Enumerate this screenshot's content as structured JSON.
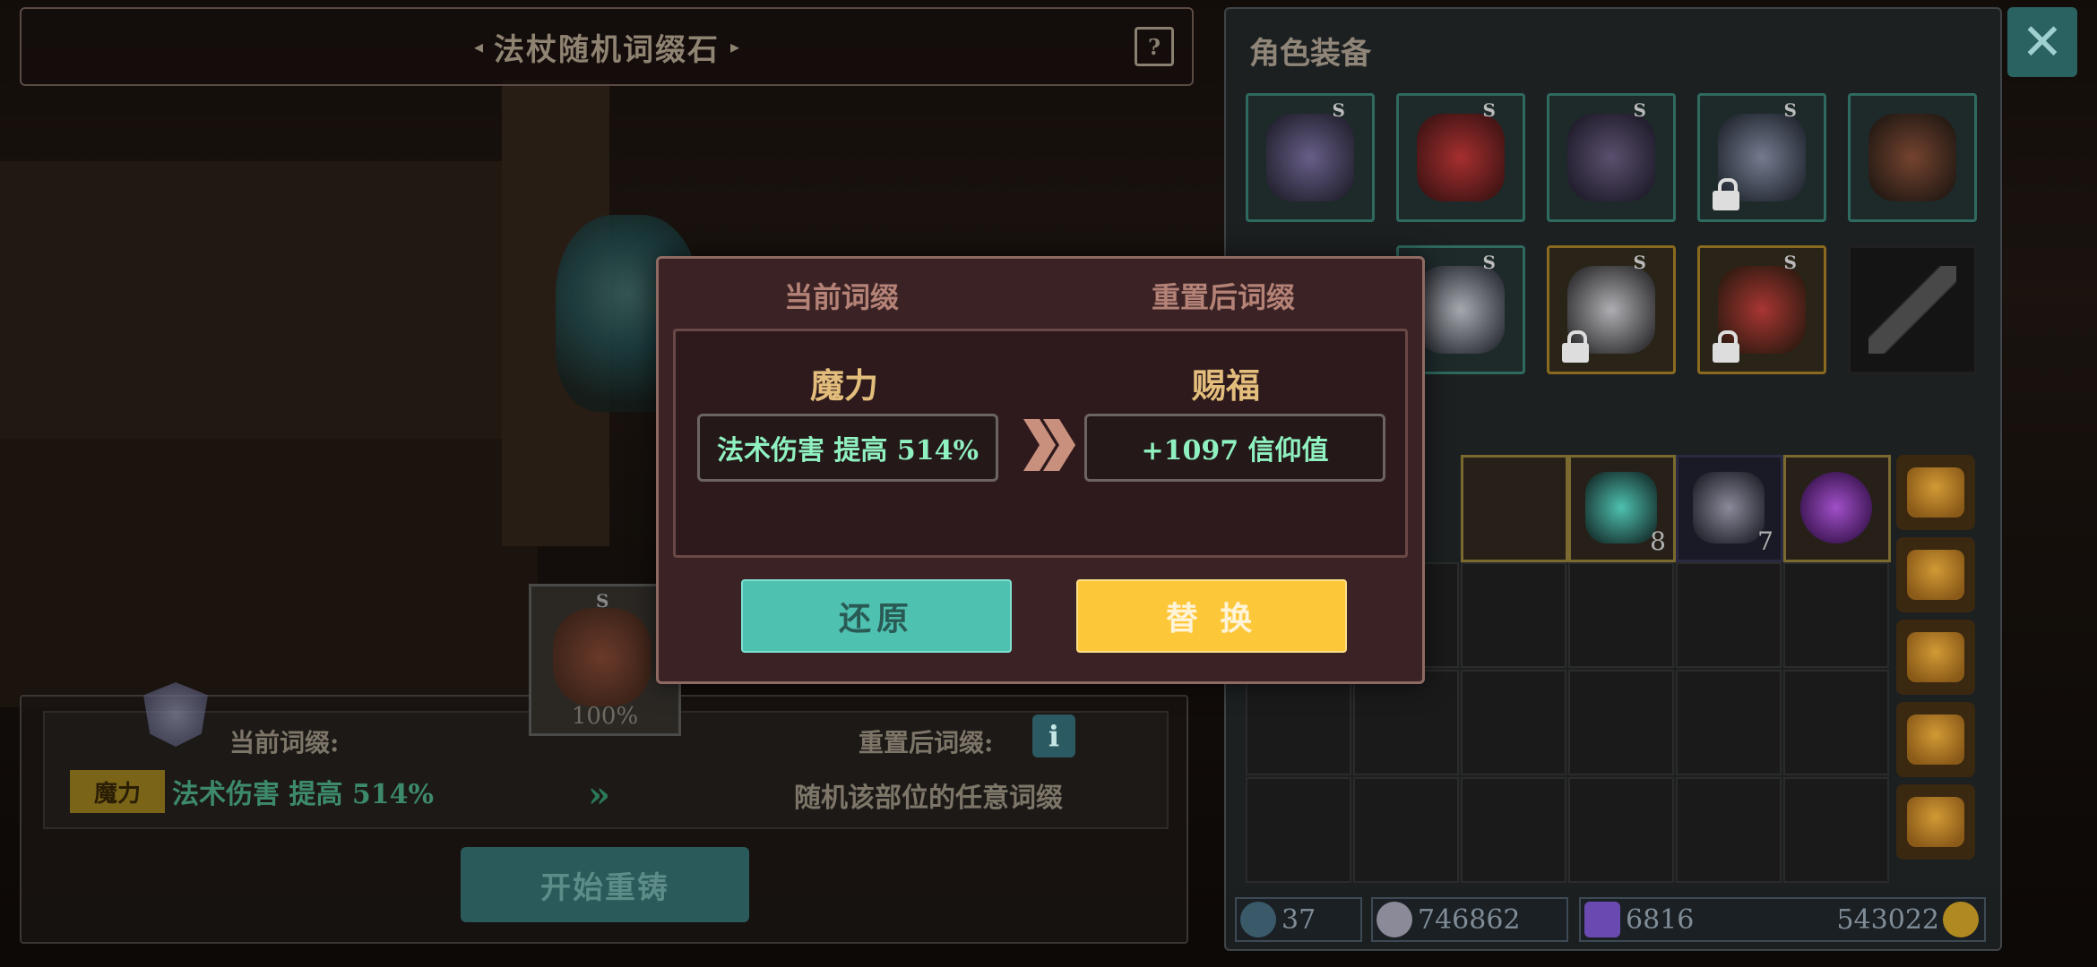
{
  "title_bar": {
    "title": "法杖随机词缀石"
  },
  "equipment": {
    "heading": "角色装备",
    "slots": [
      {
        "s": "S"
      },
      {
        "s": "S"
      },
      {
        "s": "S"
      },
      {
        "s": "S"
      },
      {
        "s": ""
      },
      {
        "s": ""
      },
      {
        "s": "S"
      },
      {
        "s": "S"
      },
      {
        "s": "S"
      },
      {
        "s": ""
      }
    ],
    "bag_items": [
      {
        "count": ""
      },
      {
        "count": ""
      },
      {
        "count": "8"
      },
      {
        "count": "7"
      },
      {
        "count": ""
      }
    ],
    "stats": {
      "level": "37",
      "hp": "746862",
      "gems": "6816",
      "gold": "543022"
    }
  },
  "reforge": {
    "current_label": "当前词缀:",
    "after_label": "重置后词缀:",
    "attr_tag": "魔力",
    "current_affix": "法术伤害 提高 514%",
    "after_affix": "随机该部位的任意词缀",
    "start_button": "开始重铸",
    "info": "i",
    "item_percent": "100%",
    "item_s": "S"
  },
  "modal": {
    "tab_current": "当前词缀",
    "tab_after": "重置后词缀",
    "current_name": "魔力",
    "current_value": "法术伤害 提高 514%",
    "after_name": "赐福",
    "after_value": "+1097 信仰值",
    "restore_button": "还原",
    "replace_button": "替 换"
  }
}
